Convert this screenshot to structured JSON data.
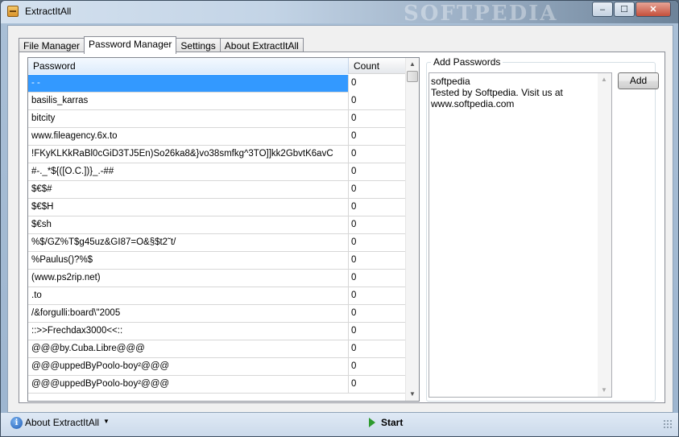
{
  "window": {
    "title": "ExtractItAll",
    "watermark": "SOFTPEDIA",
    "minimize_label": "–",
    "maximize_label": "☐",
    "close_label": "✕"
  },
  "tabs": [
    {
      "label": "File Manager"
    },
    {
      "label": "Password Manager"
    },
    {
      "label": "Settings"
    },
    {
      "label": "About ExtractItAll"
    }
  ],
  "list": {
    "headers": {
      "password": "Password",
      "count": "Count"
    },
    "rows": [
      {
        "password": "- -",
        "count": "0"
      },
      {
        "password": " basilis_karras",
        "count": "0"
      },
      {
        "password": " bitcity",
        "count": "0"
      },
      {
        "password": " www.fileagency.6x.to",
        "count": "0"
      },
      {
        "password": "!FKyKLKkRaBl0cGiD3TJ5En)So26ka8&}vo38smfkg^3TO]]kk2GbvtK6avC",
        "count": "0"
      },
      {
        "password": "#-._*${([O.C.])}_.-##",
        "count": "0"
      },
      {
        "password": "$€$#",
        "count": "0"
      },
      {
        "password": "$€$H",
        "count": "0"
      },
      {
        "password": "$€sh",
        "count": "0"
      },
      {
        "password": "%$/GZ%T$g45uz&GI87=O&§$t2˜t/",
        "count": "0"
      },
      {
        "password": "%Paulus()?%$",
        "count": "0"
      },
      {
        "password": "(www.ps2rip.net)",
        "count": "0"
      },
      {
        "password": ".to",
        "count": "0"
      },
      {
        "password": "/&forgulli:board\\\"2005",
        "count": "0"
      },
      {
        "password": "::>>Frechdax3000<<::",
        "count": "0"
      },
      {
        "password": "@@@by.Cuba.Libre@@@",
        "count": "0"
      },
      {
        "password": "@@@uppedByPoolo-boy²@@@",
        "count": "0"
      },
      {
        "password": "@@@uppedByPoolo-boy²@@@",
        "count": "0"
      }
    ]
  },
  "add_passwords": {
    "group_label": "Add Passwords",
    "text_lines": [
      "softpedia",
      "",
      "Tested by Softpedia. Visit us at",
      "www.softpedia.com"
    ],
    "add_button": "Add"
  },
  "statusbar": {
    "about_label": "About ExtractItAll",
    "start_label": "Start"
  },
  "colors": {
    "selection": "#3399ff",
    "start_icon": "#2e9b2e"
  }
}
